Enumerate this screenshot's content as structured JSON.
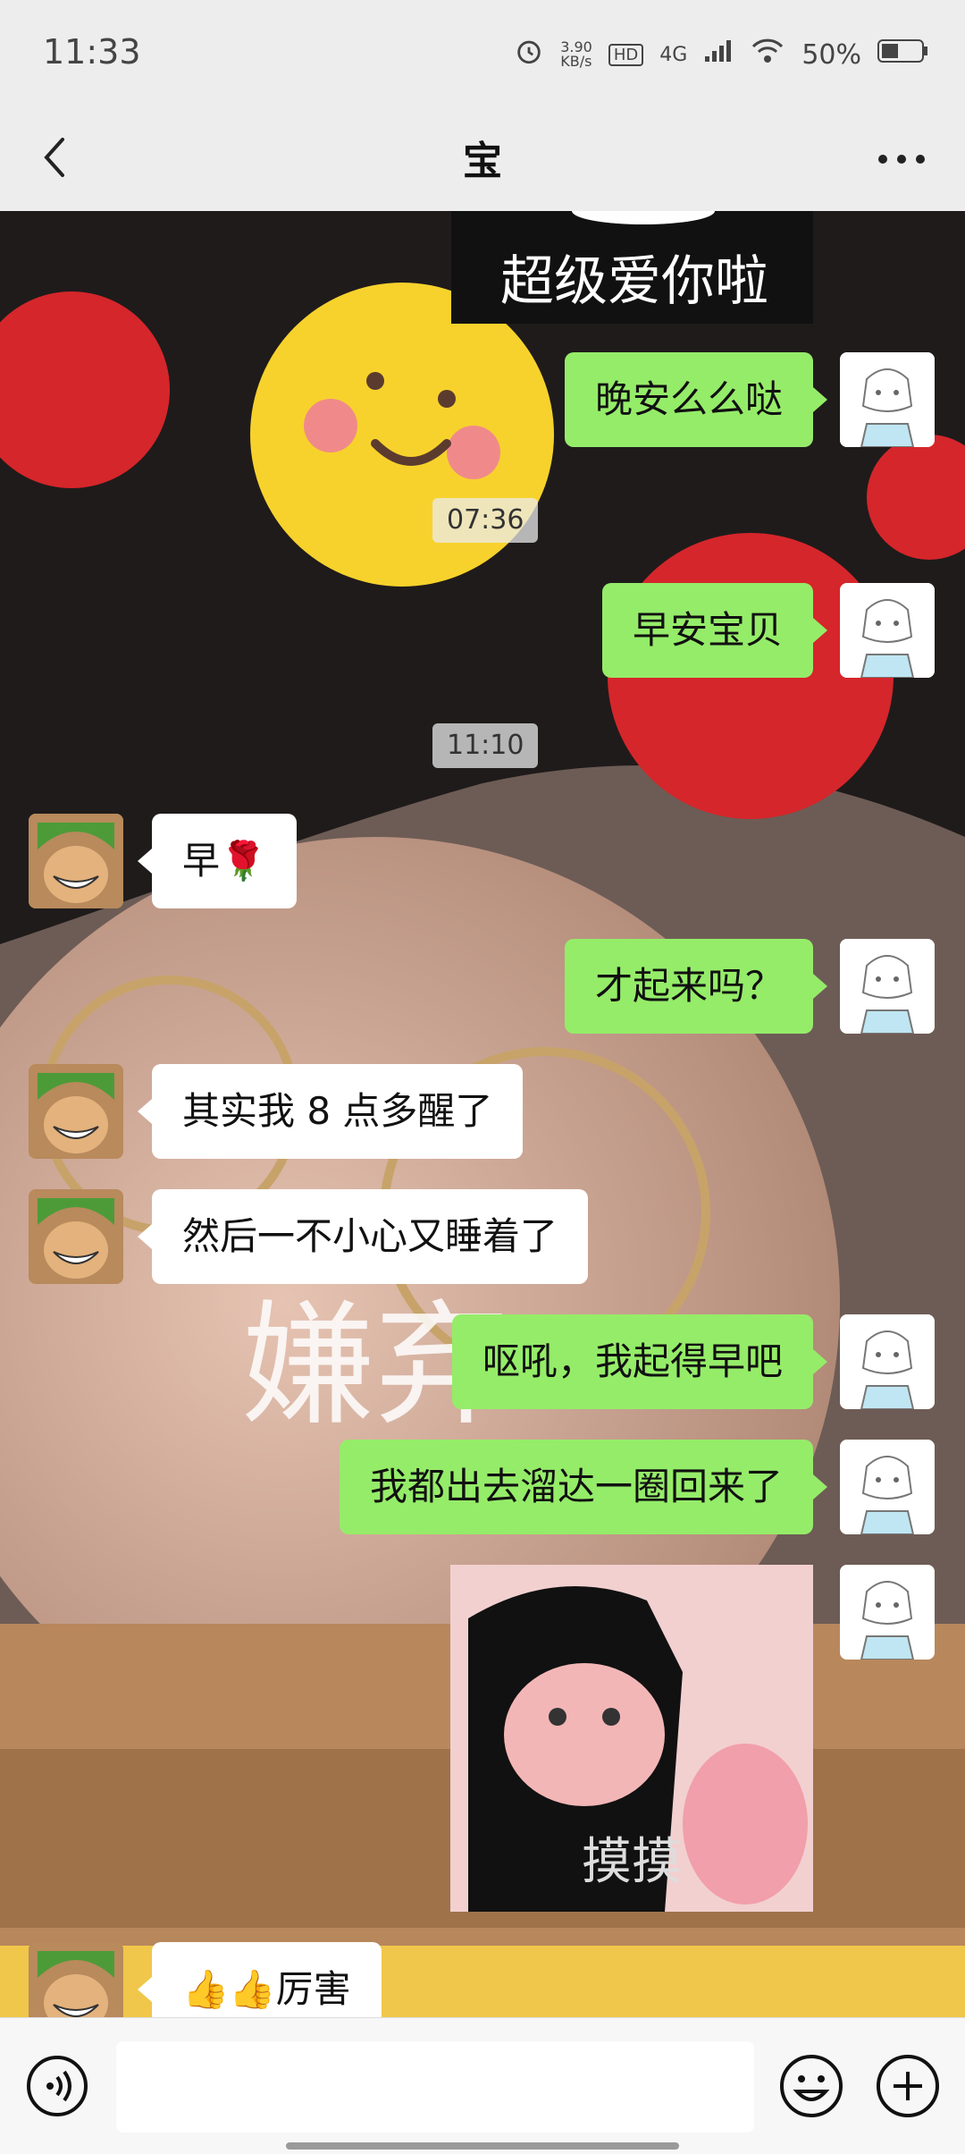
{
  "status": {
    "time": "11:33",
    "net_speed_top": "3.90",
    "net_speed_unit": "KB/s",
    "hd": "HD",
    "network": "4G",
    "battery": "50%"
  },
  "nav": {
    "title": "宝"
  },
  "messages": [
    {
      "side": "me",
      "text": "晚安么么哒"
    },
    {
      "type": "time",
      "text": "07:36"
    },
    {
      "side": "me",
      "text": "早安宝贝"
    },
    {
      "type": "time",
      "text": "11:10"
    },
    {
      "side": "other",
      "text": "早🌹"
    },
    {
      "side": "me",
      "text": "才起来吗？"
    },
    {
      "side": "other",
      "text": "其实我 8 点多醒了"
    },
    {
      "side": "other",
      "text": "然后一不小心又睡着了"
    },
    {
      "side": "me",
      "text": "呕吼，我起得早吧"
    },
    {
      "side": "me",
      "text": "我都出去溜达一圈回来了"
    },
    {
      "side": "me",
      "type": "sticker",
      "text": "摸摸"
    },
    {
      "side": "other",
      "text": "👍👍厉害"
    }
  ],
  "top_sticker_text": "超级爱你啦",
  "background_text": "嫌弃",
  "colors": {
    "bubble_me": "#95ec69",
    "bubble_other": "#ffffff"
  },
  "icons": {
    "back": "chevron-left-icon",
    "more": "more-icon",
    "voice": "voice-icon",
    "emoji": "emoji-icon",
    "plus": "plus-icon"
  }
}
